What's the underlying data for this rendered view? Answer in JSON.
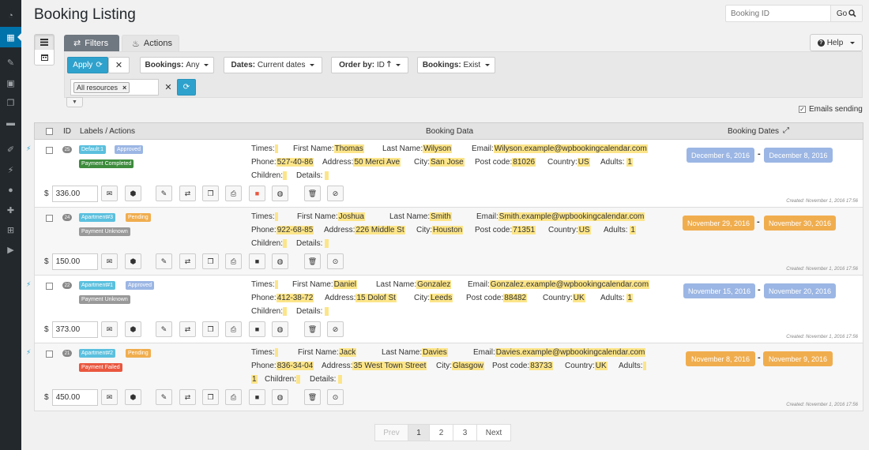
{
  "page": {
    "title": "Booking Listing"
  },
  "search": {
    "placeholder": "Booking ID",
    "go_label": "Go"
  },
  "tabs": {
    "filters": "Filters",
    "actions": "Actions"
  },
  "help": {
    "label": "Help"
  },
  "filters": {
    "apply_label": "Apply",
    "bookings_label": "Bookings:",
    "bookings_value": "Any",
    "dates_label": "Dates:",
    "dates_value": "Current dates",
    "order_label": "Order by:",
    "order_value": "ID",
    "exist_label": "Bookings:",
    "exist_value": "Exist",
    "resources_tag": "All resources"
  },
  "emails_sending": {
    "label": "Emails sending",
    "checked": true
  },
  "table": {
    "headers": {
      "id": "ID",
      "labels": "Labels / Actions",
      "data": "Booking Data",
      "dates": "Booking Dates"
    }
  },
  "field_labels": {
    "times": "Times:",
    "first_name": "First Name:",
    "last_name": "Last Name:",
    "email": "Email:",
    "phone": "Phone:",
    "address": "Address:",
    "city": "City:",
    "post_code": "Post code:",
    "country": "Country:",
    "adults": "Adults:",
    "children": "Children:",
    "details": "Details:",
    "currency": "$"
  },
  "bookings": [
    {
      "id": "25",
      "resource": "Default:1",
      "status": "Approved",
      "payment": "Payment Completed",
      "first_name": "Thomas",
      "last_name": "Wilyson",
      "email": "Wilyson.example@wpbookingcalendar.com",
      "phone": "527-40-86",
      "address": "50 Merci Ave",
      "city": "San Jose",
      "post_code": "81026",
      "country": "US",
      "adults": "1",
      "cost": "336.00",
      "date_start": "December 6, 2016",
      "date_end": "December 8, 2016",
      "created": "Created: November 1, 2016 17:56"
    },
    {
      "id": "24",
      "resource": "Apartment#3",
      "status": "Pending",
      "payment": "Payment Unknown",
      "first_name": "Joshua",
      "last_name": "Smith",
      "email": "Smith.example@wpbookingcalendar.com",
      "phone": "922-68-85",
      "address": "226 Middle St",
      "city": "Houston",
      "post_code": "71351",
      "country": "US",
      "adults": "1",
      "cost": "150.00",
      "date_start": "November 29, 2016",
      "date_end": "November 30, 2016",
      "created": "Created: November 1, 2016 17:56"
    },
    {
      "id": "22",
      "resource": "Apartment#1",
      "status": "Approved",
      "payment": "Payment Unknown",
      "first_name": "Daniel",
      "last_name": "Gonzalez",
      "email": "Gonzalez.example@wpbookingcalendar.com",
      "phone": "412-38-72",
      "address": "15 Dolof St",
      "city": "Leeds",
      "post_code": "88482",
      "country": "UK",
      "adults": "1",
      "cost": "373.00",
      "date_start": "November 15, 2016",
      "date_end": "November 20, 2016",
      "created": "Created: November 1, 2016 17:56"
    },
    {
      "id": "21",
      "resource": "Apartment#2",
      "status": "Pending",
      "payment": "Payment Failed",
      "first_name": "Jack",
      "last_name": "Davies",
      "email": "Davies.example@wpbookingcalendar.com",
      "phone": "836-34-04",
      "address": "35 West Town Street",
      "city": "Glasgow",
      "post_code": "83733",
      "country": "UK",
      "adults": "1",
      "cost": "450.00",
      "date_start": "November 8, 2016",
      "date_end": "November 9, 2016",
      "created": "Created: November 1, 2016 17:56"
    }
  ],
  "pagination": {
    "prev": "Prev",
    "pages": [
      "1",
      "2",
      "3"
    ],
    "next": "Next",
    "current": "1"
  },
  "colors": {
    "primary": "#2ea2cc",
    "approved": "#9bb6e4",
    "pending": "#f0ad4e",
    "completed": "#3d8b3d",
    "failed": "#e9573f",
    "highlight": "#fce589"
  }
}
